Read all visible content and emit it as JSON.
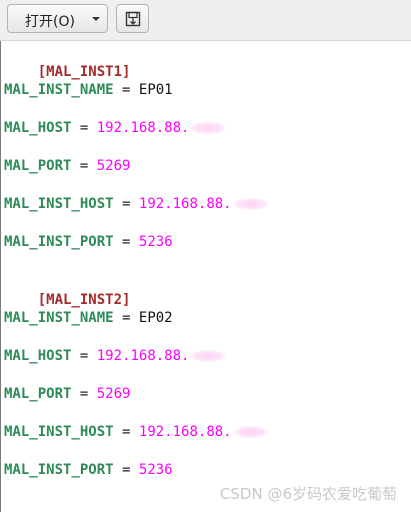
{
  "toolbar": {
    "open_label": "打开(O)",
    "open_icon": "chevron-down-icon",
    "save_icon": "save-icon"
  },
  "editor": {
    "lines": {
      "l1": {
        "section": "[MAL_INST1]"
      },
      "l2": {
        "key": "MAL_INST_NAME",
        "op": "=",
        "value": "EP01"
      },
      "l3": {
        "key": "MAL_HOST",
        "op": "=",
        "value": "192.168.88."
      },
      "l4": {
        "key": "MAL_PORT",
        "op": "=",
        "value": "5269"
      },
      "l5": {
        "key": "MAL_INST_HOST",
        "op": "=",
        "value": "192.168.88."
      },
      "l6": {
        "key": "MAL_INST_PORT",
        "op": "=",
        "value": "5236"
      },
      "l7": {
        "section": "[MAL_INST2]"
      },
      "l8": {
        "key": "MAL_INST_NAME",
        "op": "=",
        "value": "EP02"
      },
      "l9": {
        "key": "MAL_HOST",
        "op": "=",
        "value": "192.168.88."
      },
      "l10": {
        "key": "MAL_PORT",
        "op": "=",
        "value": "5269"
      },
      "l11": {
        "key": "MAL_INST_HOST",
        "op": "=",
        "value": "192.168.88."
      },
      "l12": {
        "key": "MAL_INST_PORT",
        "op": "=",
        "value": "5236"
      }
    }
  },
  "watermark": "CSDN @6岁码农爱吃葡萄",
  "colors": {
    "section": "#a52a2a",
    "key": "#2e8b57",
    "number": "#ff00ff"
  }
}
